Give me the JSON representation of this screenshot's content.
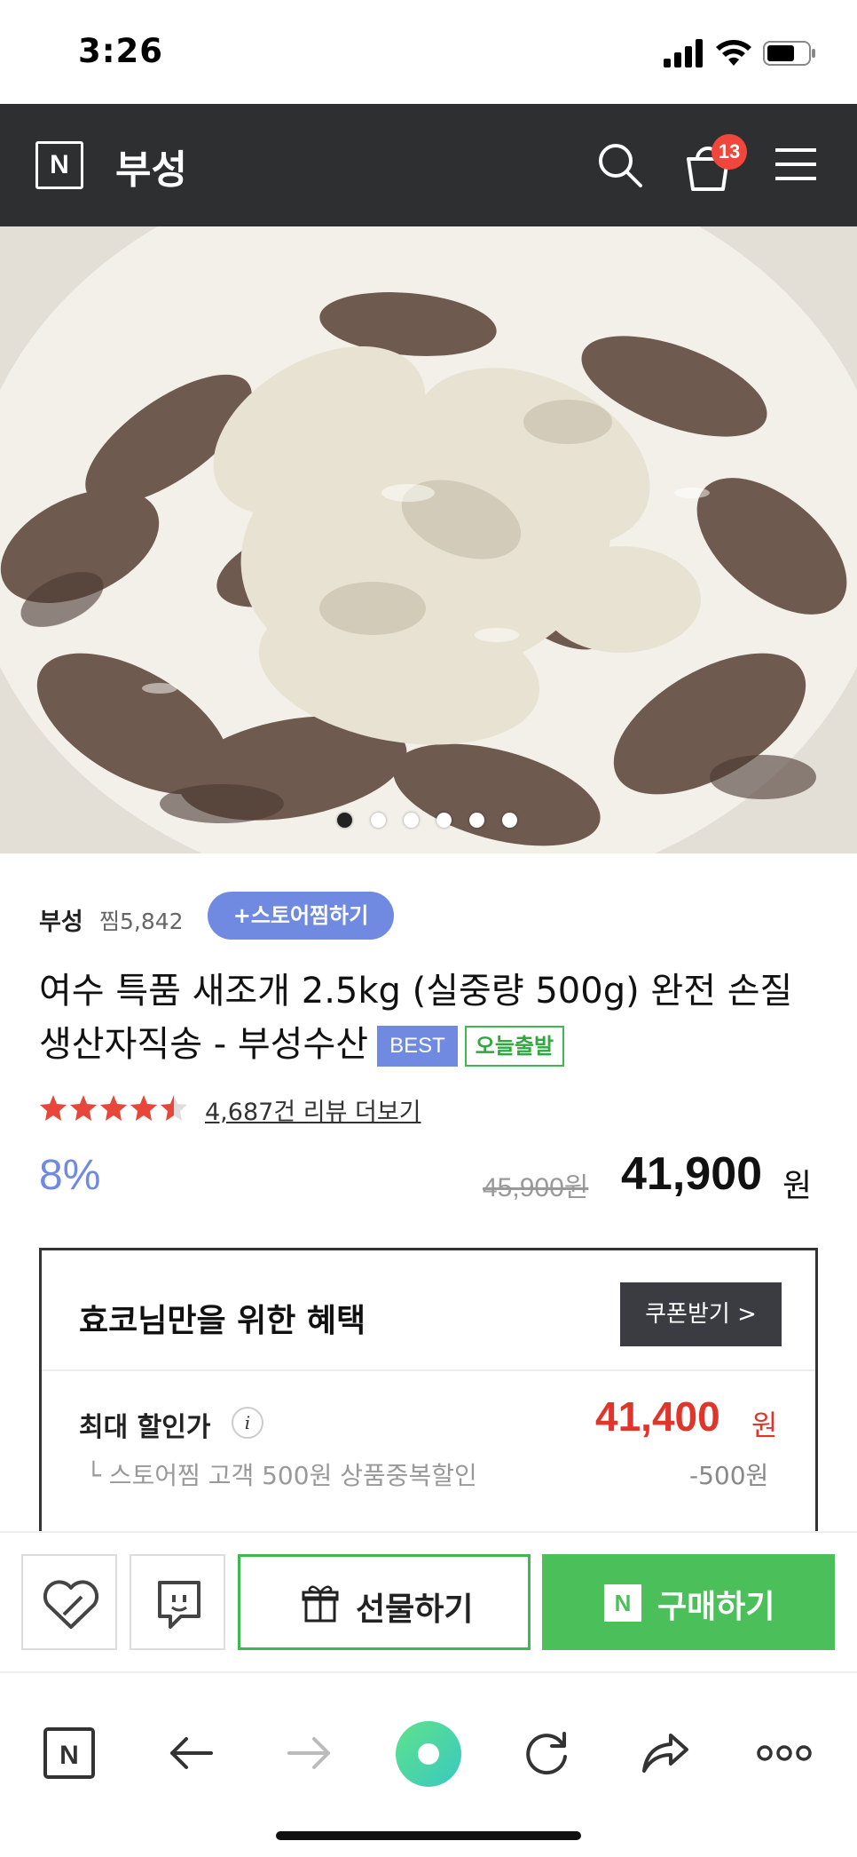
{
  "status_bar": {
    "time": "3:26"
  },
  "header": {
    "logo": "N",
    "store_name": "부성",
    "cart_count": "13",
    "icons": [
      "search-icon",
      "cart-icon",
      "menu-icon"
    ]
  },
  "gallery": {
    "total_images": 6,
    "current_index": 0
  },
  "seller": {
    "name": "부성",
    "zzim_count": "찜5,842",
    "zzim_button": "+스토어찜하기"
  },
  "product": {
    "title": "여수 특품 새조개 2.5kg (실중량 500g) 완전 손질 생산자직송 - 부성수산",
    "badge_best": "BEST",
    "badge_today": "오늘출발",
    "rating_stars": 4.5,
    "review_link": "4,687건 리뷰 더보기"
  },
  "price": {
    "discount_rate": "8%",
    "original": "45,900원",
    "sale": "41,900",
    "sale_unit": "원"
  },
  "benefit": {
    "heading": "효코님만을 위한 혜택",
    "coupon_button": "쿠폰받기 >",
    "max_label": "최대 할인가",
    "info_icon": "i",
    "max_price": "41,400",
    "max_unit": "원",
    "sub_label": "└ 스토어찜 고객 500원 상품중복할인",
    "sub_value": "-500원"
  },
  "actions": {
    "gift_label": "선물하기",
    "buy_logo": "N",
    "buy_label": "구매하기",
    "colors": {
      "buy": "#4bbf5a",
      "accent": "#6f8ae0",
      "sale_red": "#e0352b"
    }
  },
  "browser_nav": {
    "logo": "N",
    "items": [
      "home-logo-icon",
      "back-icon",
      "forward-icon",
      "green-dot-icon",
      "refresh-icon",
      "share-icon",
      "more-icon"
    ]
  }
}
